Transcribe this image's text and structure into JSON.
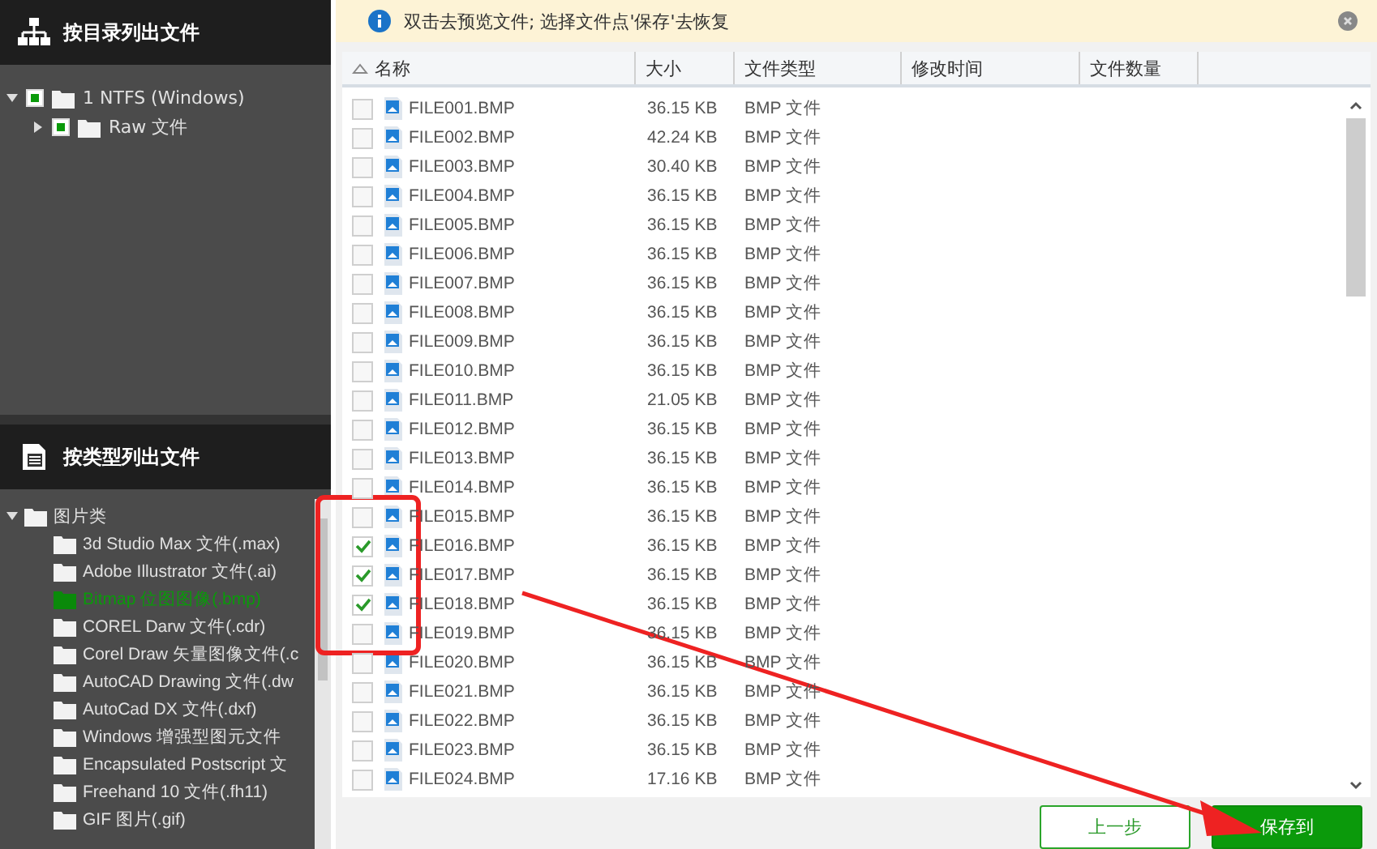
{
  "dir_panel": {
    "title": "按目录列出文件",
    "tree": [
      {
        "label": "1 NTFS (Windows)",
        "checked": true,
        "expanded": true,
        "children": [
          {
            "label": "Raw 文件",
            "checked": true,
            "expanded": false
          }
        ]
      }
    ]
  },
  "type_panel": {
    "title": "按类型列出文件",
    "tree": [
      {
        "label": "图片类",
        "expanded": true,
        "children": [
          {
            "label": "3d Studio Max 文件(.max)",
            "selected": false
          },
          {
            "label": "Adobe Illustrator 文件(.ai)",
            "selected": false
          },
          {
            "label": "Bitmap 位图图像(.bmp)",
            "selected": true
          },
          {
            "label": "COREL Darw 文件(.cdr)",
            "selected": false
          },
          {
            "label": "Corel Draw 矢量图像文件(.c",
            "selected": false
          },
          {
            "label": "AutoCAD Drawing 文件(.dw",
            "selected": false
          },
          {
            "label": "AutoCad DX 文件(.dxf)",
            "selected": false
          },
          {
            "label": "Windows 增强型图元文件",
            "selected": false
          },
          {
            "label": "Encapsulated Postscript 文",
            "selected": false
          },
          {
            "label": "Freehand 10 文件(.fh11)",
            "selected": false
          },
          {
            "label": "GIF 图片(.gif)",
            "selected": false
          }
        ]
      }
    ]
  },
  "info_bar": {
    "text": "双击去预览文件; 选择文件点'保存'去恢复"
  },
  "table": {
    "columns": [
      "名称",
      "大小",
      "文件类型",
      "修改时间",
      "文件数量"
    ],
    "rows": [
      {
        "name": "FILE001.BMP",
        "size": "36.15 KB",
        "type": "BMP 文件",
        "checked": false
      },
      {
        "name": "FILE002.BMP",
        "size": "42.24 KB",
        "type": "BMP 文件",
        "checked": false
      },
      {
        "name": "FILE003.BMP",
        "size": "30.40 KB",
        "type": "BMP 文件",
        "checked": false
      },
      {
        "name": "FILE004.BMP",
        "size": "36.15 KB",
        "type": "BMP 文件",
        "checked": false
      },
      {
        "name": "FILE005.BMP",
        "size": "36.15 KB",
        "type": "BMP 文件",
        "checked": false
      },
      {
        "name": "FILE006.BMP",
        "size": "36.15 KB",
        "type": "BMP 文件",
        "checked": false
      },
      {
        "name": "FILE007.BMP",
        "size": "36.15 KB",
        "type": "BMP 文件",
        "checked": false
      },
      {
        "name": "FILE008.BMP",
        "size": "36.15 KB",
        "type": "BMP 文件",
        "checked": false
      },
      {
        "name": "FILE009.BMP",
        "size": "36.15 KB",
        "type": "BMP 文件",
        "checked": false
      },
      {
        "name": "FILE010.BMP",
        "size": "36.15 KB",
        "type": "BMP 文件",
        "checked": false
      },
      {
        "name": "FILE011.BMP",
        "size": "21.05 KB",
        "type": "BMP 文件",
        "checked": false
      },
      {
        "name": "FILE012.BMP",
        "size": "36.15 KB",
        "type": "BMP 文件",
        "checked": false
      },
      {
        "name": "FILE013.BMP",
        "size": "36.15 KB",
        "type": "BMP 文件",
        "checked": false
      },
      {
        "name": "FILE014.BMP",
        "size": "36.15 KB",
        "type": "BMP 文件",
        "checked": false
      },
      {
        "name": "FILE015.BMP",
        "size": "36.15 KB",
        "type": "BMP 文件",
        "checked": false
      },
      {
        "name": "FILE016.BMP",
        "size": "36.15 KB",
        "type": "BMP 文件",
        "checked": true
      },
      {
        "name": "FILE017.BMP",
        "size": "36.15 KB",
        "type": "BMP 文件",
        "checked": true
      },
      {
        "name": "FILE018.BMP",
        "size": "36.15 KB",
        "type": "BMP 文件",
        "checked": true
      },
      {
        "name": "FILE019.BMP",
        "size": "36.15 KB",
        "type": "BMP 文件",
        "checked": false
      },
      {
        "name": "FILE020.BMP",
        "size": "36.15 KB",
        "type": "BMP 文件",
        "checked": false
      },
      {
        "name": "FILE021.BMP",
        "size": "36.15 KB",
        "type": "BMP 文件",
        "checked": false
      },
      {
        "name": "FILE022.BMP",
        "size": "36.15 KB",
        "type": "BMP 文件",
        "checked": false
      },
      {
        "name": "FILE023.BMP",
        "size": "36.15 KB",
        "type": "BMP 文件",
        "checked": false
      },
      {
        "name": "FILE024.BMP",
        "size": "17.16 KB",
        "type": "BMP 文件",
        "checked": false
      }
    ]
  },
  "buttons": [
    {
      "label": "上一步",
      "kind": "secondary"
    },
    {
      "label": "保存到",
      "kind": "primary"
    }
  ]
}
